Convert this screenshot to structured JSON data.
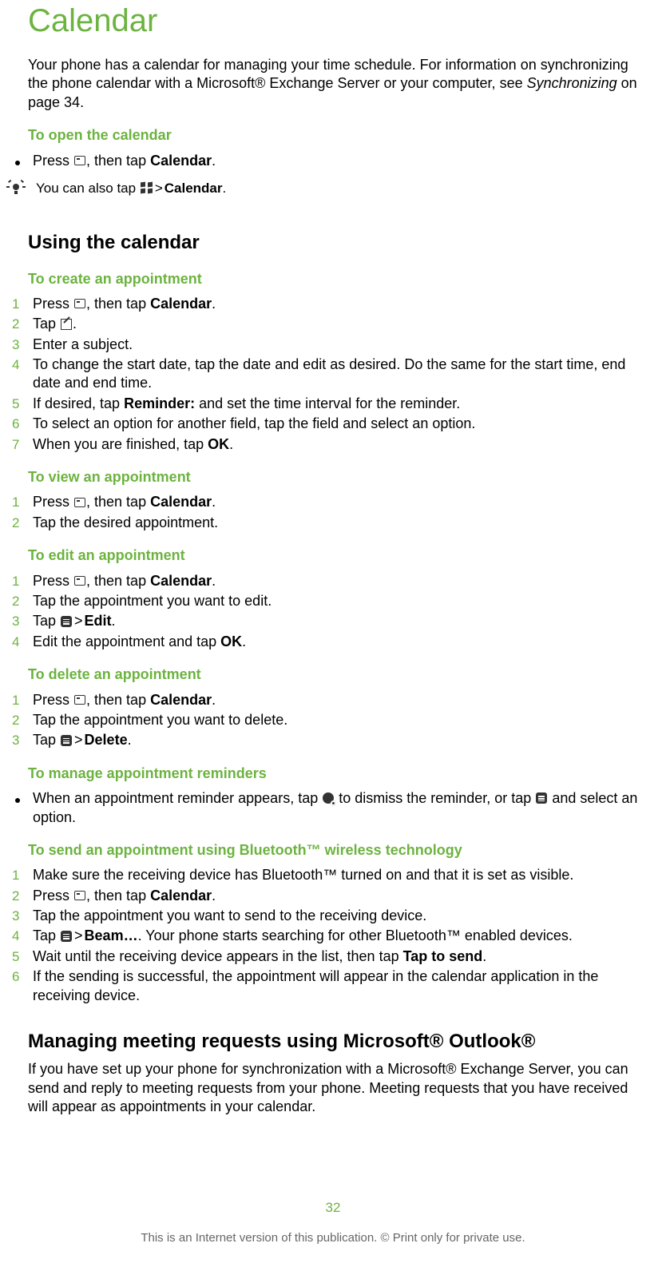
{
  "title": "Calendar",
  "intro": {
    "p1a": "Your phone has a calendar for managing your time schedule. For information on synchronizing the phone calendar with a Microsoft® Exchange Server or your computer, see ",
    "p1_italic": "Synchronizing",
    "p1b": " on page 34."
  },
  "open": {
    "heading": "To open the calendar",
    "bullet": {
      "a": "Press ",
      "b": ", then tap ",
      "bold": "Calendar",
      "c": "."
    },
    "tip": {
      "a": "You can also tap ",
      "b": " > ",
      "bold": "Calendar",
      "c": "."
    }
  },
  "using": {
    "heading": "Using the calendar",
    "create": {
      "heading": "To create an appointment",
      "steps": [
        {
          "n": "1",
          "a": "Press ",
          "b": ", then tap ",
          "bold": "Calendar",
          "c": "."
        },
        {
          "n": "2",
          "a": "Tap ",
          "c": "."
        },
        {
          "n": "3",
          "text": "Enter a subject."
        },
        {
          "n": "4",
          "text": "To change the start date, tap the date and edit as desired. Do the same for the start time, end date and end time."
        },
        {
          "n": "5",
          "a": "If desired, tap ",
          "bold": "Reminder:",
          "b": " and set the time interval for the reminder."
        },
        {
          "n": "6",
          "text": "To select an option for another field, tap the field and select an option."
        },
        {
          "n": "7",
          "a": "When you are finished, tap ",
          "bold": "OK",
          "b": "."
        }
      ]
    },
    "view": {
      "heading": "To view an appointment",
      "steps": [
        {
          "n": "1",
          "a": "Press ",
          "b": ", then tap ",
          "bold": "Calendar",
          "c": "."
        },
        {
          "n": "2",
          "text": "Tap the desired appointment."
        }
      ]
    },
    "edit": {
      "heading": "To edit an appointment",
      "steps": [
        {
          "n": "1",
          "a": "Press ",
          "b": ", then tap ",
          "bold": "Calendar",
          "c": "."
        },
        {
          "n": "2",
          "text": "Tap the appointment you want to edit."
        },
        {
          "n": "3",
          "a": "Tap ",
          "b": " > ",
          "bold": "Edit",
          "c": "."
        },
        {
          "n": "4",
          "a": "Edit the appointment and tap ",
          "bold": "OK",
          "b": "."
        }
      ]
    },
    "del": {
      "heading": "To delete an appointment",
      "steps": [
        {
          "n": "1",
          "a": "Press ",
          "b": ", then tap ",
          "bold": "Calendar",
          "c": "."
        },
        {
          "n": "2",
          "text": "Tap the appointment you want to delete."
        },
        {
          "n": "3",
          "a": "Tap ",
          "b": " > ",
          "bold": "Delete",
          "c": "."
        }
      ]
    },
    "reminders": {
      "heading": "To manage appointment reminders",
      "bullet": {
        "a": "When an appointment reminder appears, tap ",
        "b": " to dismiss the reminder, or tap ",
        "c": " and select an option."
      }
    },
    "bt": {
      "heading": "To send an appointment using Bluetooth™ wireless technology",
      "steps": [
        {
          "n": "1",
          "text": "Make sure the receiving device has Bluetooth™ turned on and that it is set as visible."
        },
        {
          "n": "2",
          "a": "Press ",
          "b": ", then tap ",
          "bold": "Calendar",
          "c": "."
        },
        {
          "n": "3",
          "text": "Tap the appointment you want to send to the receiving device."
        },
        {
          "n": "4",
          "a": "Tap ",
          "b": " > ",
          "bold": "Beam…",
          "c": ". Your phone starts searching for other Bluetooth™ enabled devices."
        },
        {
          "n": "5",
          "a": "Wait until the receiving device appears in the list, then tap ",
          "bold": "Tap to send",
          "b": "."
        },
        {
          "n": "6",
          "text": "If the sending is successful, the appointment will appear in the calendar application in the receiving device."
        }
      ]
    }
  },
  "outlook": {
    "heading": "Managing meeting requests using Microsoft® Outlook®",
    "p": "If you have set up your phone for synchronization with a Microsoft® Exchange Server, you can send and reply to meeting requests from your phone. Meeting requests that you have received will appear as appointments in your calendar."
  },
  "footer": {
    "page": "32",
    "note": "This is an Internet version of this publication. © Print only for private use."
  },
  "gt": ">"
}
